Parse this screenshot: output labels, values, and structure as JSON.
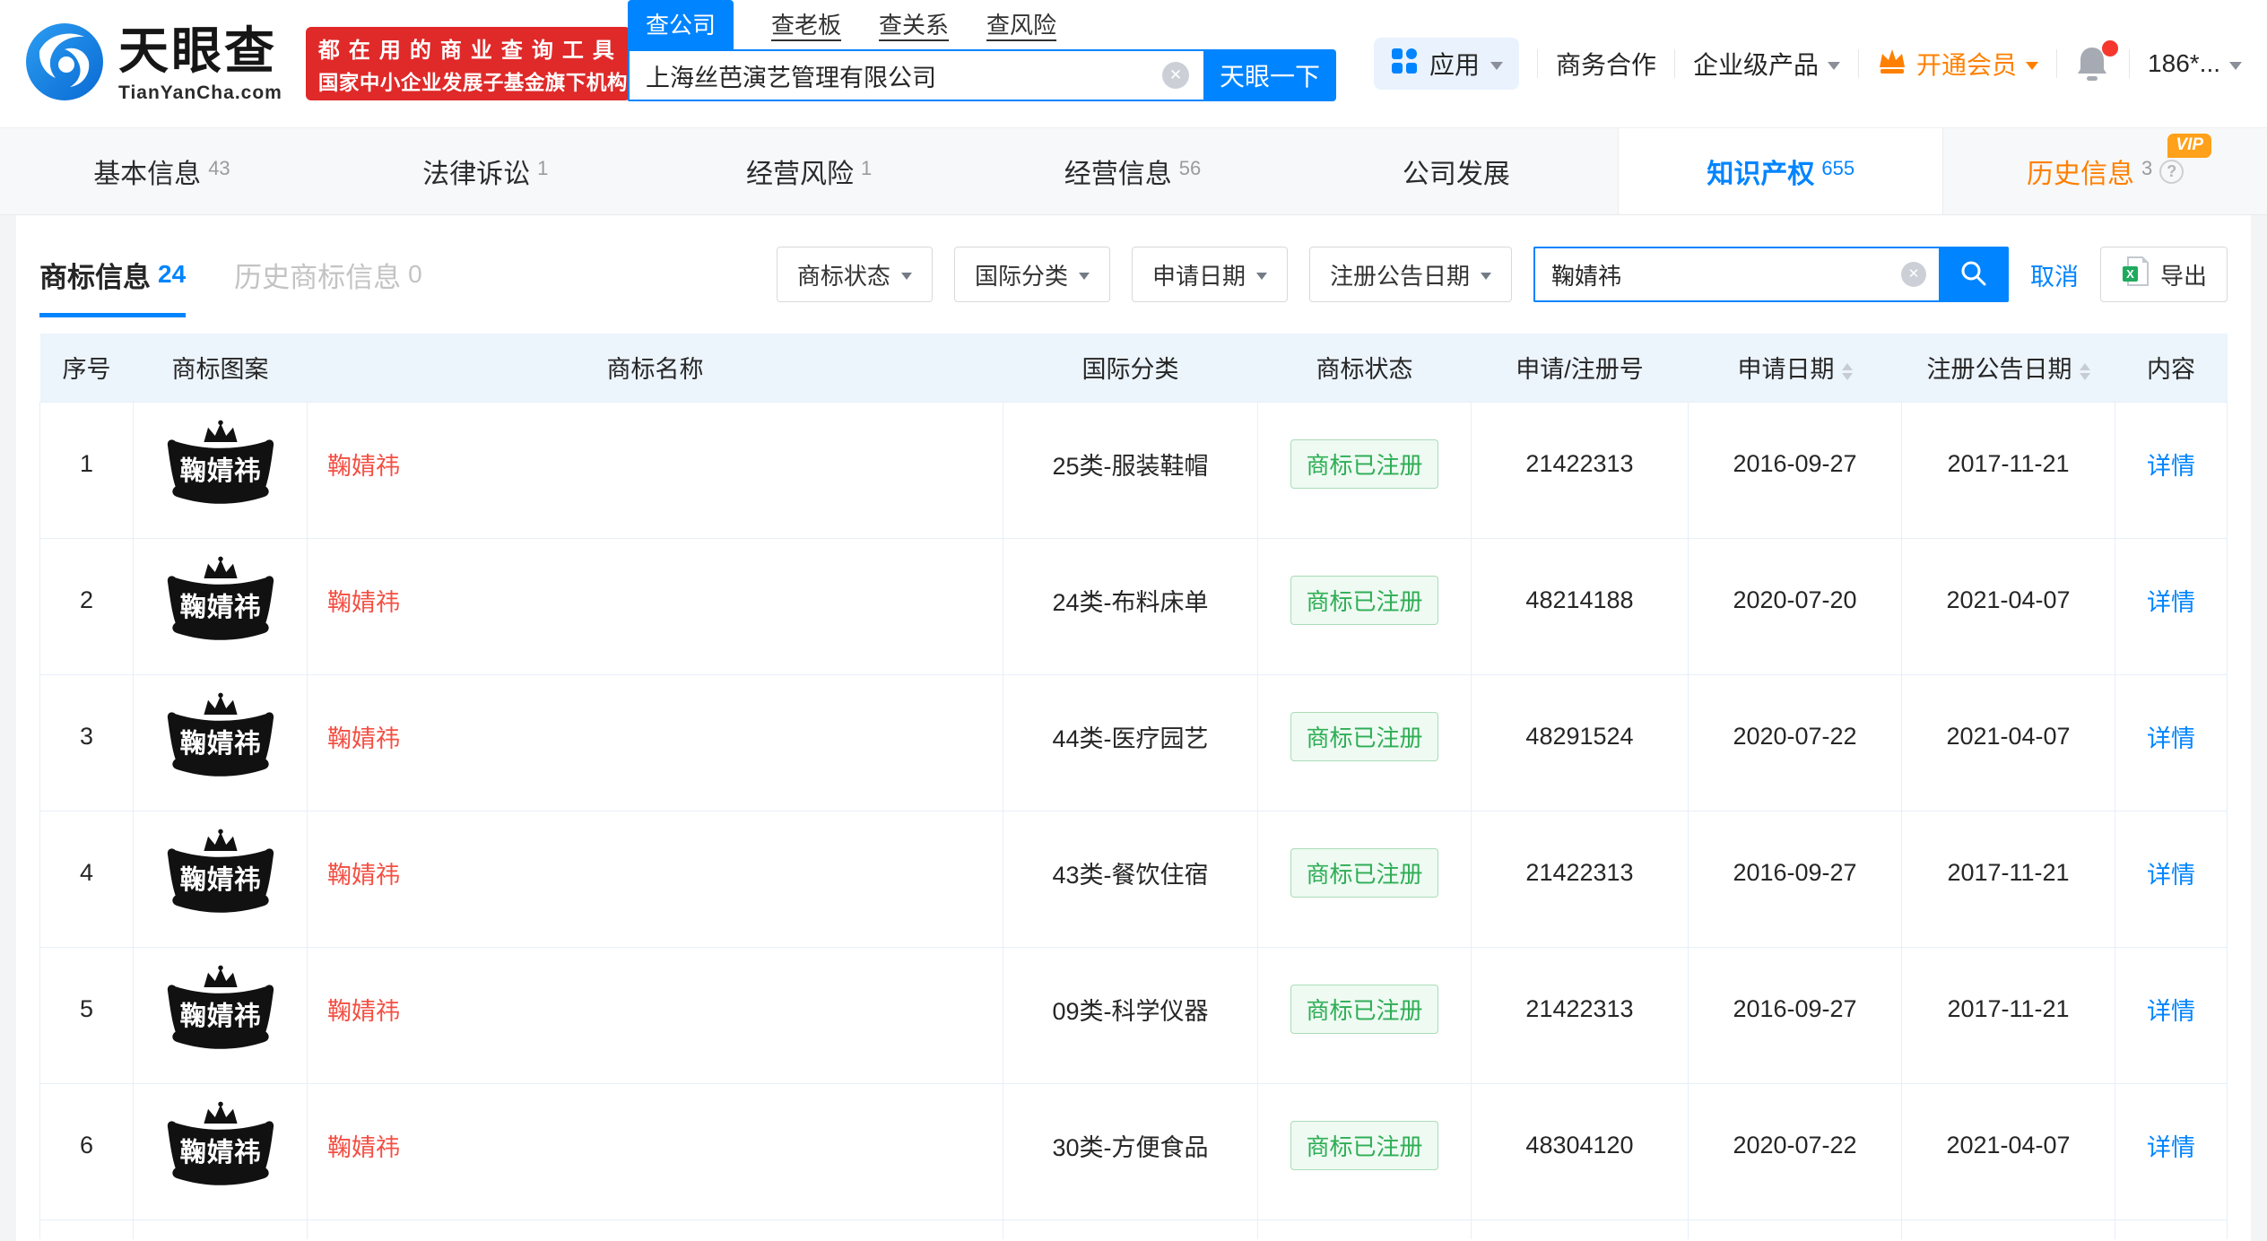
{
  "brand": {
    "logo_text": "天眼查",
    "logo_domain": "TianYanCha.com",
    "slogan_line1": "都在用的商业查询工具",
    "slogan_line2": "国家中小企业发展子基金旗下机构"
  },
  "top_search": {
    "tabs": [
      {
        "label": "查公司"
      },
      {
        "label": "查老板"
      },
      {
        "label": "查关系"
      },
      {
        "label": "查风险"
      }
    ],
    "value": "上海丝芭演艺管理有限公司",
    "submit_label": "天眼一下"
  },
  "top_nav": {
    "app_label": "应用",
    "biz_label": "商务合作",
    "enterprise_label": "企业级产品",
    "vip_label": "开通会员",
    "phone": "186*..."
  },
  "company_tabs": [
    {
      "label": "基本信息",
      "count": "43"
    },
    {
      "label": "法律诉讼",
      "count": "1"
    },
    {
      "label": "经营风险",
      "count": "1"
    },
    {
      "label": "经营信息",
      "count": "56"
    },
    {
      "label": "公司发展",
      "count": ""
    },
    {
      "label": "知识产权",
      "count": "655"
    },
    {
      "label": "历史信息",
      "count": "3",
      "badge": "VIP"
    }
  ],
  "section": {
    "tabs": [
      {
        "label": "商标信息",
        "count": "24"
      },
      {
        "label": "历史商标信息",
        "count": "0"
      }
    ],
    "filters": [
      {
        "label": "商标状态"
      },
      {
        "label": "国际分类"
      },
      {
        "label": "申请日期"
      },
      {
        "label": "注册公告日期"
      }
    ],
    "search": {
      "value": "鞠婧祎"
    },
    "cancel_label": "取消",
    "export_label": "导出"
  },
  "table": {
    "columns": {
      "no": "序号",
      "image": "商标图案",
      "name": "商标名称",
      "intl_class": "国际分类",
      "status": "商标状态",
      "reg_no": "申请/注册号",
      "apply_date": "申请日期",
      "publish_date": "注册公告日期",
      "content": "内容"
    },
    "rows": [
      {
        "no": "1",
        "name": "鞠婧祎",
        "intl_class": "25类-服装鞋帽",
        "status": "商标已注册",
        "reg_no": "21422313",
        "apply_date": "2016-09-27",
        "publish_date": "2017-11-21",
        "detail": "详情"
      },
      {
        "no": "2",
        "name": "鞠婧祎",
        "intl_class": "24类-布料床单",
        "status": "商标已注册",
        "reg_no": "48214188",
        "apply_date": "2020-07-20",
        "publish_date": "2021-04-07",
        "detail": "详情"
      },
      {
        "no": "3",
        "name": "鞠婧祎",
        "intl_class": "44类-医疗园艺",
        "status": "商标已注册",
        "reg_no": "48291524",
        "apply_date": "2020-07-22",
        "publish_date": "2021-04-07",
        "detail": "详情"
      },
      {
        "no": "4",
        "name": "鞠婧祎",
        "intl_class": "43类-餐饮住宿",
        "status": "商标已注册",
        "reg_no": "21422313",
        "apply_date": "2016-09-27",
        "publish_date": "2017-11-21",
        "detail": "详情"
      },
      {
        "no": "5",
        "name": "鞠婧祎",
        "intl_class": "09类-科学仪器",
        "status": "商标已注册",
        "reg_no": "21422313",
        "apply_date": "2016-09-27",
        "publish_date": "2017-11-21",
        "detail": "详情"
      },
      {
        "no": "6",
        "name": "鞠婧祎",
        "intl_class": "30类-方便食品",
        "status": "商标已注册",
        "reg_no": "48304120",
        "apply_date": "2020-07-22",
        "publish_date": "2021-04-07",
        "detail": "详情"
      }
    ]
  },
  "colors": {
    "brand_blue": "#0084ff",
    "banner_red": "#e02929",
    "vip_orange": "#ff8000",
    "badge_green": "#2fae55",
    "trademark_name_red": "#f34f43",
    "table_header_bg": "#ecf4fc"
  }
}
